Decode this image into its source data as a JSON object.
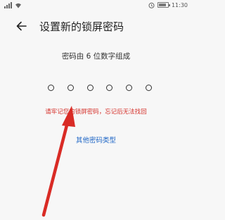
{
  "status_bar": {
    "time": "11:30",
    "signal_icon": "cellular-signal-icon",
    "wifi_icon": "wifi-icon",
    "alarm_icon": "alarm-icon",
    "battery_icon": "battery-icon",
    "battery_level": 0.8
  },
  "header": {
    "back_icon": "back-arrow-icon",
    "title": "设置新的锁屏密码"
  },
  "pin": {
    "hint": "密码由 6 位数字组成",
    "length": 6,
    "entered": 0
  },
  "warning": "请牢记您的锁屏密码，忘记后无法找回",
  "other_password_type": "其他密码类型",
  "colors": {
    "warning": "#d5312b",
    "link": "#1f66c6",
    "annotation_arrow": "#d92b25"
  }
}
